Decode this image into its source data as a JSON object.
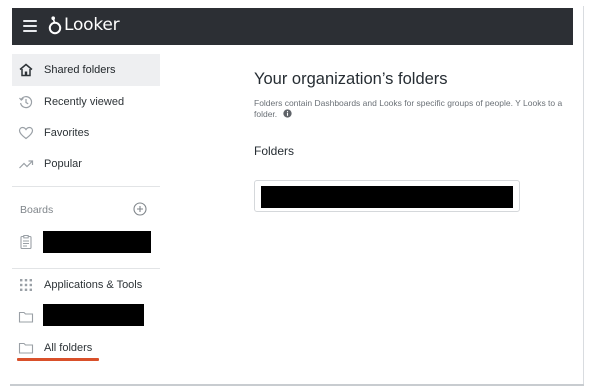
{
  "header": {
    "app_name": "Looker",
    "bg_color": "#2c2f34"
  },
  "sidebar": {
    "items": [
      {
        "label": "Shared folders",
        "icon": "home-icon",
        "active": true
      },
      {
        "label": "Recently viewed",
        "icon": "history-icon",
        "active": false
      },
      {
        "label": "Favorites",
        "icon": "heart-icon",
        "active": false
      },
      {
        "label": "Popular",
        "icon": "trending-icon",
        "active": false
      }
    ],
    "boards_label": "Boards",
    "boards_add_icon": "add-circle-icon",
    "board_item_icon": "board-icon",
    "applications_label": "Applications & Tools",
    "applications_icon": "apps-grid-icon",
    "folder_icon": "folder-icon",
    "all_folders_label": "All folders",
    "highlight_color": "#d9502a"
  },
  "main": {
    "title": "Your organization’s folders",
    "description": "Folders contain Dashboards and Looks for specific groups of people. Y Looks to a folder.",
    "info_icon": "info-icon",
    "folders_heading": "Folders"
  }
}
